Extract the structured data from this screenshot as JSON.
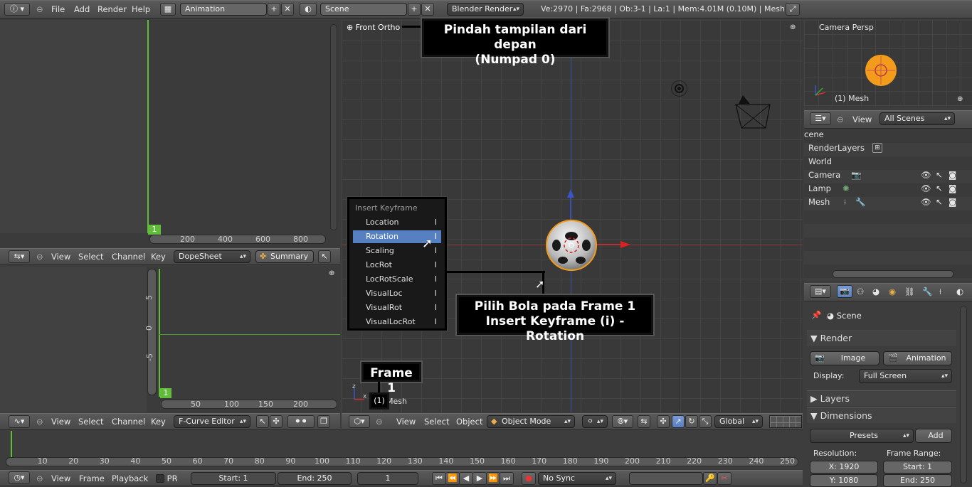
{
  "info_header": {
    "menus": [
      "File",
      "Add",
      "Render",
      "Help"
    ],
    "layout_name": "Animation",
    "scene_name": "Scene",
    "render_engine": "Blender Render",
    "stats": "Ve:2970 | Fa:2968 | Ob:3-1 | La:1 | Mem:4.01M (0.10M) | Mesh"
  },
  "dopesheet": {
    "current_frame": "1",
    "ruler": [
      "200",
      "400",
      "600",
      "800"
    ],
    "menus": [
      "View",
      "Select",
      "Channel",
      "Key"
    ],
    "mode": "DopeSheet",
    "summary_label": "Summary"
  },
  "graph_editor": {
    "current_frame": "1",
    "y_ticks": [
      "5",
      "0",
      "-5"
    ],
    "ruler": [
      "50",
      "100",
      "150",
      "200"
    ],
    "menus": [
      "View",
      "Select",
      "Channel",
      "Key"
    ],
    "mode": "F-Curve Editor"
  },
  "viewport": {
    "view_name": "Front Ortho",
    "object_label": "(1) Mesh",
    "frame_badge": "(1)",
    "mesh_text": "Mesh",
    "menus": [
      "View",
      "Select",
      "Object"
    ],
    "mode": "Object Mode",
    "orientation": "Global"
  },
  "insert_keyframe_menu": {
    "title": "Insert Keyframe",
    "items": [
      {
        "label": "Location",
        "shortcut": "I"
      },
      {
        "label": "Rotation",
        "shortcut": "I"
      },
      {
        "label": "Scaling",
        "shortcut": "I"
      },
      {
        "label": "LocRot",
        "shortcut": "I"
      },
      {
        "label": "LocRotScale",
        "shortcut": "I"
      },
      {
        "label": "VisualLoc",
        "shortcut": "I"
      },
      {
        "label": "VisualRot",
        "shortcut": "I"
      },
      {
        "label": "VisualLocRot",
        "shortcut": "I"
      }
    ],
    "selected_index": 1
  },
  "callouts": {
    "front_view": "Pindah tampilan dari depan\n(Numpad 0)",
    "keyframe": "Pilih Bola pada Frame 1\nInsert Keyframe (i) - Rotation",
    "frame": "Frame 1"
  },
  "camera_view": {
    "title": "Camera Persp",
    "object_label": "(1) Mesh"
  },
  "outliner": {
    "view_menu": "View",
    "scenes_dropdown": "All Scenes",
    "rows": [
      {
        "label": "cene"
      },
      {
        "label": "RenderLayers"
      },
      {
        "label": "World"
      },
      {
        "label": "Camera"
      },
      {
        "label": "Lamp"
      },
      {
        "label": "Mesh"
      }
    ]
  },
  "properties": {
    "scene_label": "Scene",
    "render_panel": "Render",
    "image_button": "Image",
    "animation_button": "Animation",
    "display_label": "Display:",
    "display_value": "Full Screen",
    "layers_panel": "Layers",
    "dimensions_panel": "Dimensions",
    "presets": "Presets",
    "add": "Add",
    "resolution_label": "Resolution:",
    "frame_range_label": "Frame Range:",
    "res_x": "X: 1920",
    "res_y": "Y: 1080",
    "start": "Start: 1",
    "end": "End: 250"
  },
  "timeline": {
    "ruler": [
      "10",
      "20",
      "30",
      "40",
      "50",
      "60",
      "70",
      "80",
      "90",
      "100",
      "110",
      "120",
      "130",
      "140",
      "150",
      "160",
      "170",
      "180",
      "190",
      "200",
      "210",
      "220",
      "230",
      "240",
      "250"
    ],
    "menus": [
      "View",
      "Frame",
      "Playback"
    ],
    "pr_label": "PR",
    "start": "Start: 1",
    "end": "End: 250",
    "current": "1",
    "sync": "No Sync"
  },
  "colors": {
    "accent": "#5680c2",
    "frame_green": "#5fbd3a",
    "ball_orange": "#f39c1c"
  }
}
